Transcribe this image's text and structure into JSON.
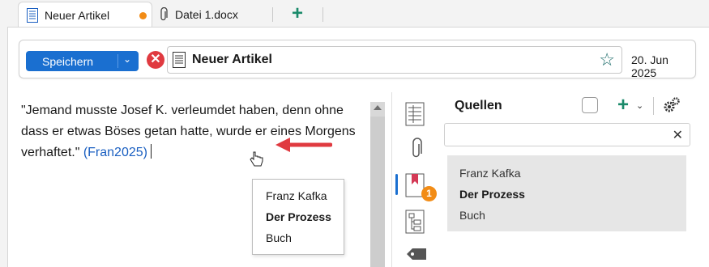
{
  "tabs": [
    {
      "label": "Neuer Artikel",
      "active": true,
      "modified": true
    },
    {
      "label": "Datei 1.docx",
      "active": false
    }
  ],
  "toolbar": {
    "save_label": "Speichern",
    "title": "Neuer Artikel",
    "date": "20. Jun 2025"
  },
  "editor": {
    "text_before": "\"Jemand musste Josef K. verleumdet haben, denn ohne dass er etwas Böses getan hatte, wurde er ei­nes Morgens verhaftet.\" ",
    "citation": "(Fran2025)"
  },
  "popup": {
    "author": "Franz Kafka",
    "title": "Der Prozess",
    "type": "Buch"
  },
  "sources": {
    "heading": "Quellen",
    "badge_count": "1",
    "search_placeholder": "",
    "items": [
      {
        "author": "Franz Kafka",
        "title": "Der Prozess",
        "type": "Buch"
      }
    ]
  },
  "icons": [
    "document-icon",
    "paperclip-icon",
    "plus-icon",
    "close-icon",
    "star-add-icon",
    "table-icon",
    "bookmark-icon",
    "outline-icon",
    "tag-icon",
    "gears-icon",
    "red-arrow-icon",
    "hand-cursor-icon"
  ],
  "colors": {
    "accent": "#1a6fd0",
    "orange": "#f28c16",
    "green": "#1a8a6a",
    "red": "#e03a40"
  }
}
